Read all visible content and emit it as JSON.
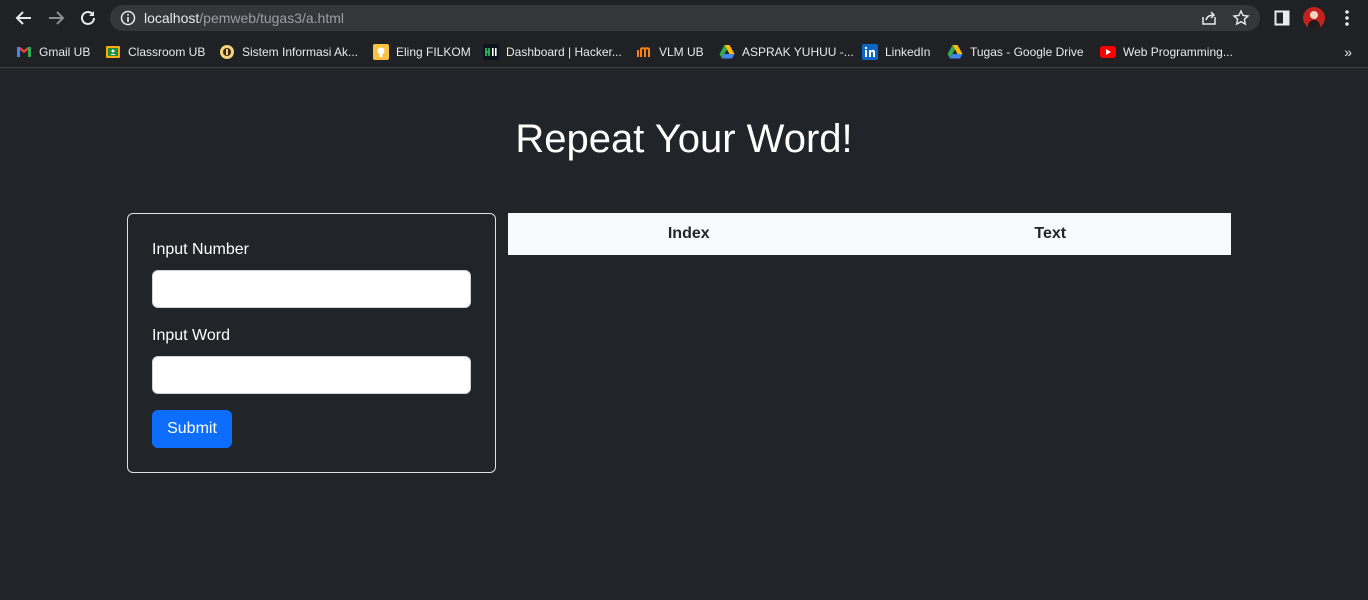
{
  "browser": {
    "url_host": "localhost",
    "url_path": "/pemweb/tugas3/a.html",
    "bookmarks": [
      {
        "label": "Gmail UB",
        "icon": "gmail-icon"
      },
      {
        "label": "Classroom UB",
        "icon": "classroom-icon"
      },
      {
        "label": "Sistem Informasi Ak...",
        "icon": "university-icon"
      },
      {
        "label": "Eling FILKOM",
        "icon": "lightbulb-icon"
      },
      {
        "label": "Dashboard | Hacker...",
        "icon": "hackerrank-icon"
      },
      {
        "label": "VLM UB",
        "icon": "vlm-icon"
      },
      {
        "label": "ASPRAK YUHUU -...",
        "icon": "google-drive-icon"
      },
      {
        "label": "LinkedIn",
        "icon": "linkedin-icon"
      },
      {
        "label": "Tugas - Google Drive",
        "icon": "google-drive-icon"
      },
      {
        "label": "Web Programming...",
        "icon": "youtube-icon"
      }
    ],
    "more": "»"
  },
  "page": {
    "title": "Repeat Your Word!",
    "form": {
      "number_label": "Input Number",
      "number_value": "",
      "word_label": "Input Word",
      "word_value": "",
      "submit_label": "Submit"
    },
    "table": {
      "headers": [
        "Index",
        "Text"
      ]
    }
  },
  "colors": {
    "page_bg": "#212529",
    "primary": "#0d6efd",
    "table_header_bg": "#f8f9fa"
  }
}
